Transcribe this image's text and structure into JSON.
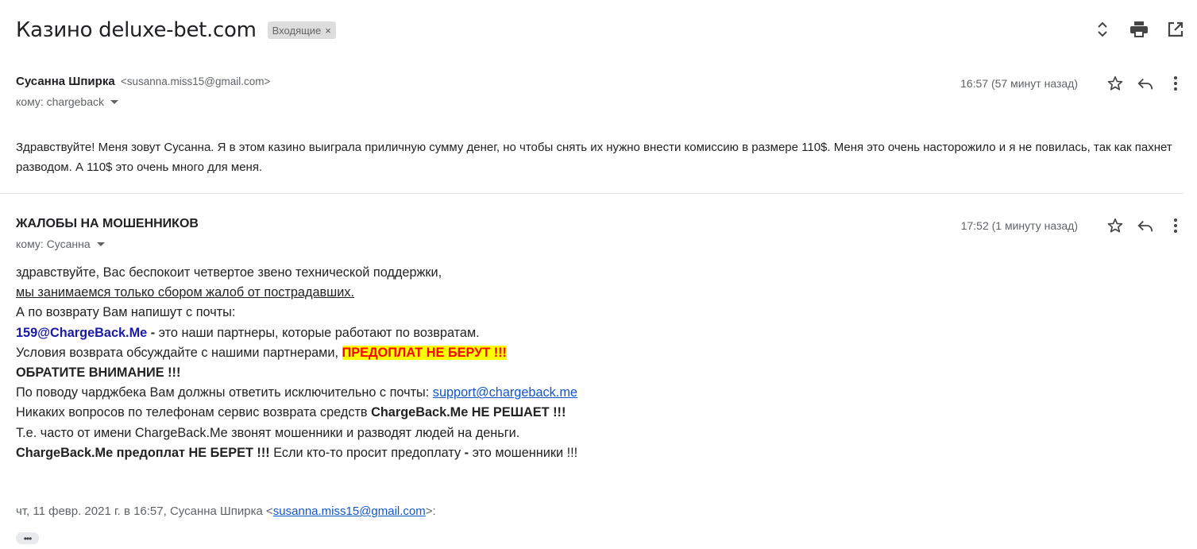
{
  "thread": {
    "subject": "Казино deluxe-bet.com",
    "label": "Входящие",
    "label_close": "×"
  },
  "toolbar": {
    "icons": [
      "expand-collapse-icon",
      "print-icon",
      "open-new-window-icon"
    ]
  },
  "message1": {
    "sender_name": "Сусанна Шпирка",
    "sender_email": "<susanna.miss15@gmail.com>",
    "to": "кому: chargeback",
    "time": "16:57 (57 минут назад)",
    "body": "Здравствуйте! Меня зовут Сусанна. Я в этом казино выиграла приличную сумму денег, но чтобы снять их нужно внести комиссию в размере 110$. Меня это очень насторожило и я не повилась, так как пахнет разводом. А 110$  это очень много для меня."
  },
  "message2": {
    "sender_name": "ЖАЛОБЫ НА МОШЕННИКОВ",
    "to": "кому: Сусанна",
    "time": "17:52 (1 минуту назад)",
    "l1": "здравствуйте, Вас беспокоит четвертое звено технической поддержки,",
    "l2": "мы занимаемся только сбором жалоб от пострадавших.",
    "l3": "А по возврату Вам напишут с почты:",
    "l4_email": "159@ChargeBack.Me",
    "l4_dash": " - ",
    "l4_rest": "это наши партнеры, которые работают по возвратам.",
    "l5_text": "Условия возврата обсуждайте с нашими партнерами, ",
    "l5_highlight": "ПРЕДОПЛАТ НЕ БЕРУТ !!!",
    "l6": "ОБРАТИТЕ ВНИМАНИЕ !!!",
    "l7_text": "По поводу чарджбека Вам должны ответить исключительно с почты: ",
    "l7_link": "support@chargeback.me",
    "l8_text": "Никаких вопросов по телефонам сервис возврата средств ",
    "l8_bold": "ChargeBack.Me НЕ РЕШАЕТ !!!",
    "l9": "Т.е. часто от имени ChargeBack.Me звонят мошенники и разводят людей на деньги.",
    "l10_bold": "ChargeBack.Me предоплат НЕ БЕРЕТ !!!",
    "l10_text": " Если кто-то просит предоплату ",
    "l10_dash": "-",
    "l10_end": " это мошенники !!!",
    "quote_prefix": "чт, 11 февр. 2021 г. в 16:57, Сусанна Шпирка <",
    "quote_email": "susanna.miss15@gmail.com",
    "quote_suffix": ">:",
    "ellipsis": "•••"
  }
}
